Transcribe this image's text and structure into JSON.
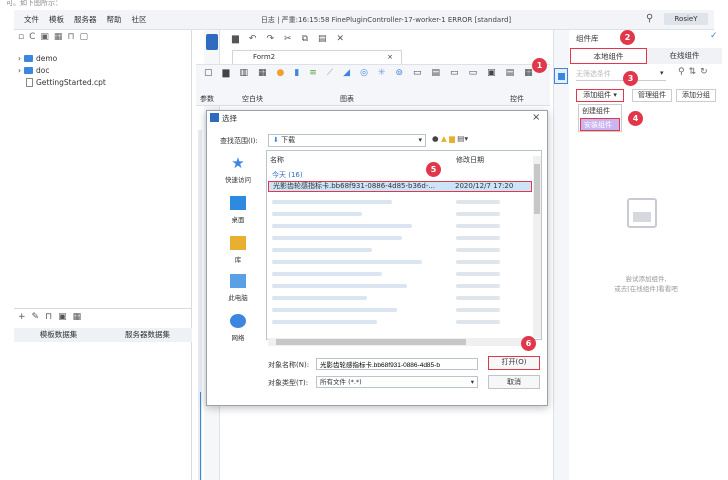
{
  "top_strip": "可。如下图所示：",
  "menu": [
    "文件",
    "模板",
    "服务器",
    "帮助",
    "社区"
  ],
  "window_title": "日志 | 严重:16:15:58 FinePluginController-17-worker-1 ERROR [standard]",
  "user_name": "RosieY",
  "tree": [
    {
      "label": "demo",
      "type": "folder"
    },
    {
      "label": "doc",
      "type": "folder"
    },
    {
      "label": "GettingStarted.cpt",
      "type": "file"
    }
  ],
  "left_tabs": [
    "模板数据集",
    "服务器数据集"
  ],
  "form_tab": "Form2",
  "ribbon_labels": {
    "params": "参数",
    "blank": "空白块",
    "chart": "图表",
    "controls": "控件"
  },
  "right_pane": {
    "title": "组件库",
    "tabs": [
      "本地组件",
      "在线组件"
    ],
    "filter_placeholder": "无筛选条件",
    "add_button": "添加组件",
    "manage_button": "管理组件",
    "group_button": "添加分组",
    "dropdown": [
      "创建组件",
      "安装组件"
    ],
    "empty_line1": "尝试添加组件,",
    "empty_line2": "或去[在线组件]看看吧"
  },
  "badges": [
    "1",
    "2",
    "3",
    "4",
    "5",
    "6"
  ],
  "dialog": {
    "title": "选择",
    "lookin_label": "查找范围(I):",
    "lookin_value": "下载",
    "places": [
      "快速访问",
      "桌面",
      "库",
      "此电脑",
      "网络"
    ],
    "col_name": "名称",
    "col_date": "修改日期",
    "group": "今天 (16)",
    "selected_file": "光影齿轮感指标卡.bb68f931-0886-4d85-b36d-...",
    "selected_date": "2020/12/7 17:20",
    "filename_label": "对象名称(N):",
    "filename_value": "光影齿轮感指标卡.bb68f931-0886-4d85-b",
    "filetype_label": "对象类型(T):",
    "filetype_value": "所有文件 (*.*)",
    "open_button": "打开(O)",
    "cancel_button": "取消"
  },
  "colors": {
    "accent": "#3d86e0",
    "highlight": "#e0384a"
  }
}
